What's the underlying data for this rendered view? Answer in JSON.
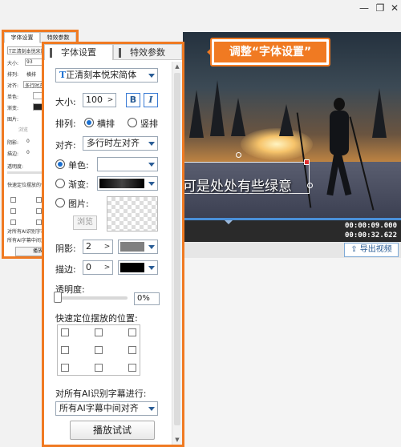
{
  "window": {
    "minimize": "—",
    "restore": "❐",
    "close": "✕"
  },
  "small_panel": {
    "tabs": [
      "字体设置",
      "特效参数"
    ],
    "font": "T正清刻本悦宋简体",
    "size_label": "大小:",
    "size_value": "93",
    "layout_label": "排列:",
    "layout_option": "横排",
    "align_label": "对齐:",
    "align_value": "多行时左",
    "single_label": "单色:",
    "gradient_label": "渐变:",
    "image_label": "图片:",
    "browse": "浏览",
    "shadow_label": "阴影:",
    "shadow_value": "0",
    "stroke_label": "描边:",
    "stroke_value": "0",
    "opacity_label": "透明度:",
    "position_label": "快速定位摆放的位置:",
    "ai_label": "对所有AI识别字幕进行:",
    "ai_value": "所有AI字幕中间对齐",
    "play": "播放试"
  },
  "panel": {
    "tabs": [
      "字体设置",
      "特效参数"
    ],
    "font": {
      "icon": "T",
      "name": "正清刻本悦宋简体"
    },
    "size": {
      "label": "大小:",
      "value": "100",
      "bold": "B",
      "italic": "I"
    },
    "layout": {
      "label": "排列:",
      "options": [
        "横排",
        "竖排"
      ]
    },
    "align": {
      "label": "对齐:",
      "value": "多行时左对齐"
    },
    "color": {
      "single": "单色:",
      "gradient": "渐变:",
      "image": "图片:",
      "browse": "浏览"
    },
    "shadow": {
      "label": "阴影:",
      "value": "2"
    },
    "stroke": {
      "label": "描边:",
      "value": "0"
    },
    "opacity": {
      "label": "透明度:",
      "value": "0%"
    },
    "position": {
      "label": "快速定位摆放的位置:"
    },
    "ai": {
      "label": "对所有AI识别字幕进行:",
      "value": "所有AI字幕中间对齐"
    },
    "play": "播放试试"
  },
  "preview": {
    "subtitle": "可是处处有些绿意",
    "callout": "调整“字体设置”"
  },
  "timeline": {
    "current_time": "00:00:09.000",
    "total_time": "00:00:32.622"
  },
  "export_button": "导出视频",
  "colors": {
    "accent": "#f07a22",
    "primary": "#1a6fd0",
    "shadow_swatch": "#808080",
    "stroke_swatch": "#000000"
  }
}
